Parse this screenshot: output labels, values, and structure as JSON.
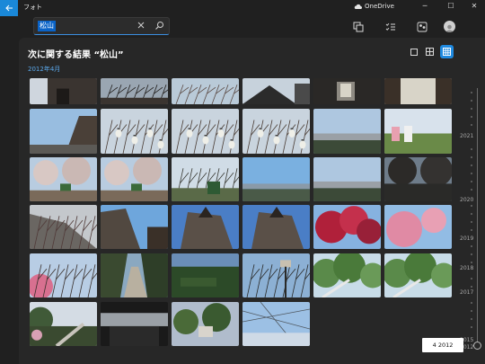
{
  "window": {
    "app_title": "フォト",
    "onedrive_label": "OneDrive",
    "minimize_glyph": "─",
    "maximize_glyph": "☐",
    "close_glyph": "✕"
  },
  "search": {
    "query": "松山"
  },
  "results": {
    "title": "次に関する結果 “松山”",
    "date_group": "2012年4月"
  },
  "photos": [
    {
      "scene": "temple-gate"
    },
    {
      "scene": "dark-branches"
    },
    {
      "scene": "tree-sky"
    },
    {
      "scene": "castle-roof"
    },
    {
      "scene": "dark-corridor"
    },
    {
      "scene": "bright-gate"
    },
    {
      "scene": "castle-wall"
    },
    {
      "scene": "lanterns"
    },
    {
      "scene": "lanterns"
    },
    {
      "scene": "lanterns"
    },
    {
      "scene": "city-view"
    },
    {
      "scene": "people-bench"
    },
    {
      "scene": "park-trees"
    },
    {
      "scene": "park-trees"
    },
    {
      "scene": "hill-tree"
    },
    {
      "scene": "blue-sky-city"
    },
    {
      "scene": "city-view"
    },
    {
      "scene": "dark-park"
    },
    {
      "scene": "stone-wall"
    },
    {
      "scene": "gate-blue"
    },
    {
      "scene": "castle-walls"
    },
    {
      "scene": "castle-walls"
    },
    {
      "scene": "red-blossom"
    },
    {
      "scene": "pink-blossom"
    },
    {
      "scene": "pink-blossom-sky"
    },
    {
      "scene": "path-trees"
    },
    {
      "scene": "green-hill"
    },
    {
      "scene": "sign-sky"
    },
    {
      "scene": "ropeway-green"
    },
    {
      "scene": "ropeway-green"
    },
    {
      "scene": "ropeway-down"
    },
    {
      "scene": "dark-station"
    },
    {
      "scene": "village-trees"
    },
    {
      "scene": "wires-sky"
    }
  ],
  "timeline": {
    "years": [
      "2021",
      "2020",
      "2019",
      "2018",
      "2017",
      "2015",
      "2012"
    ],
    "tooltip": "4 2012"
  },
  "colors": {
    "accent": "#1f8ae0",
    "background": "#202020",
    "content": "#272727"
  }
}
